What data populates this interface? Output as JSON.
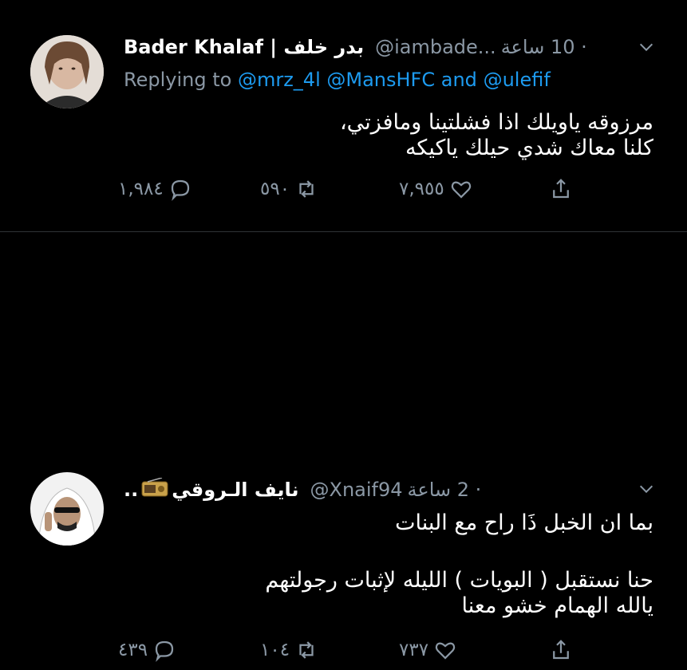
{
  "tweets": [
    {
      "author_name": "Bader Khalaf | بدر خلف",
      "handle": "@iambade...",
      "time": "· 10 ساعة",
      "replying": {
        "prefix": "Replying to",
        "m1": "@mrz_4l",
        "m2": "@MansHFC",
        "and": "and",
        "m3": "@ulefif"
      },
      "lines": [
        "مرزوقه ياويلك اذا فشلتينا ومافزتي،",
        "كلنا معاك شدي حيلك ياكيكه"
      ],
      "replies": "١,٩٨٤",
      "retweets": "٥٩٠",
      "likes": "٧,٩٥٥"
    },
    {
      "author_name": "نايف الـروقي",
      "name_suffix": "..",
      "handle": "@Xnaif94",
      "time": "· 2 ساعة",
      "lines": [
        "بما ان الخبل ذَا راح مع البنات",
        "حنا نستقبل ( البويات ) الليله لإثبات رجولتهم",
        "يالله الهمام خشو معنا"
      ],
      "replies": "٤٣٩",
      "retweets": "١٠٤",
      "likes": "٧٣٧"
    }
  ],
  "colors": {
    "background": "#000000",
    "text": "#ffffff",
    "muted": "#8b98a5",
    "link": "#1d9bf0"
  },
  "icons": [
    "chevron-down-icon",
    "reply-icon",
    "retweet-icon",
    "like-icon",
    "share-icon",
    "radio-emoji-icon"
  ]
}
